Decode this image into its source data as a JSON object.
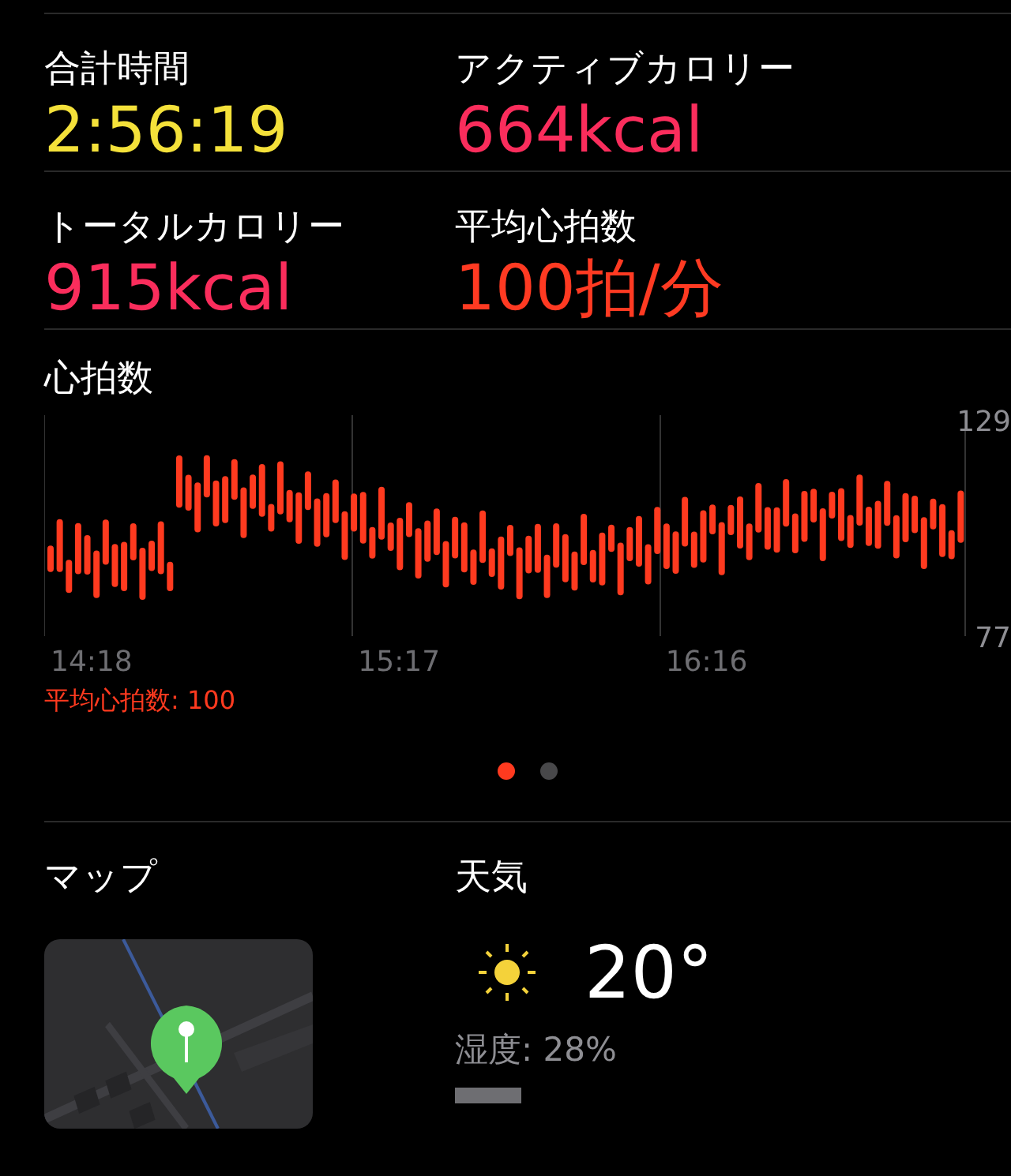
{
  "stats": [
    {
      "label": "合計時間",
      "value": "2:56:19",
      "color": "#f4e13a"
    },
    {
      "label": "アクティブカロリー",
      "value": "664kcal",
      "color": "#fa2d5c"
    },
    {
      "label": "トータルカロリー",
      "value": "915kcal",
      "color": "#fa2d5c"
    },
    {
      "label": "平均心拍数",
      "value": "100拍/分",
      "color": "#ff3a22"
    }
  ],
  "heart_rate": {
    "title": "心拍数",
    "y_max": "129",
    "y_min": "77",
    "times": [
      "14:18",
      "15:17",
      "16:16"
    ],
    "average": "平均心拍数: 100"
  },
  "pages": [
    {
      "selected": true
    },
    {
      "selected": false
    }
  ],
  "map": {
    "title": "マップ"
  },
  "weather": {
    "title": "天気",
    "temperature": "20°",
    "humidity": "湿度: 28%"
  }
}
